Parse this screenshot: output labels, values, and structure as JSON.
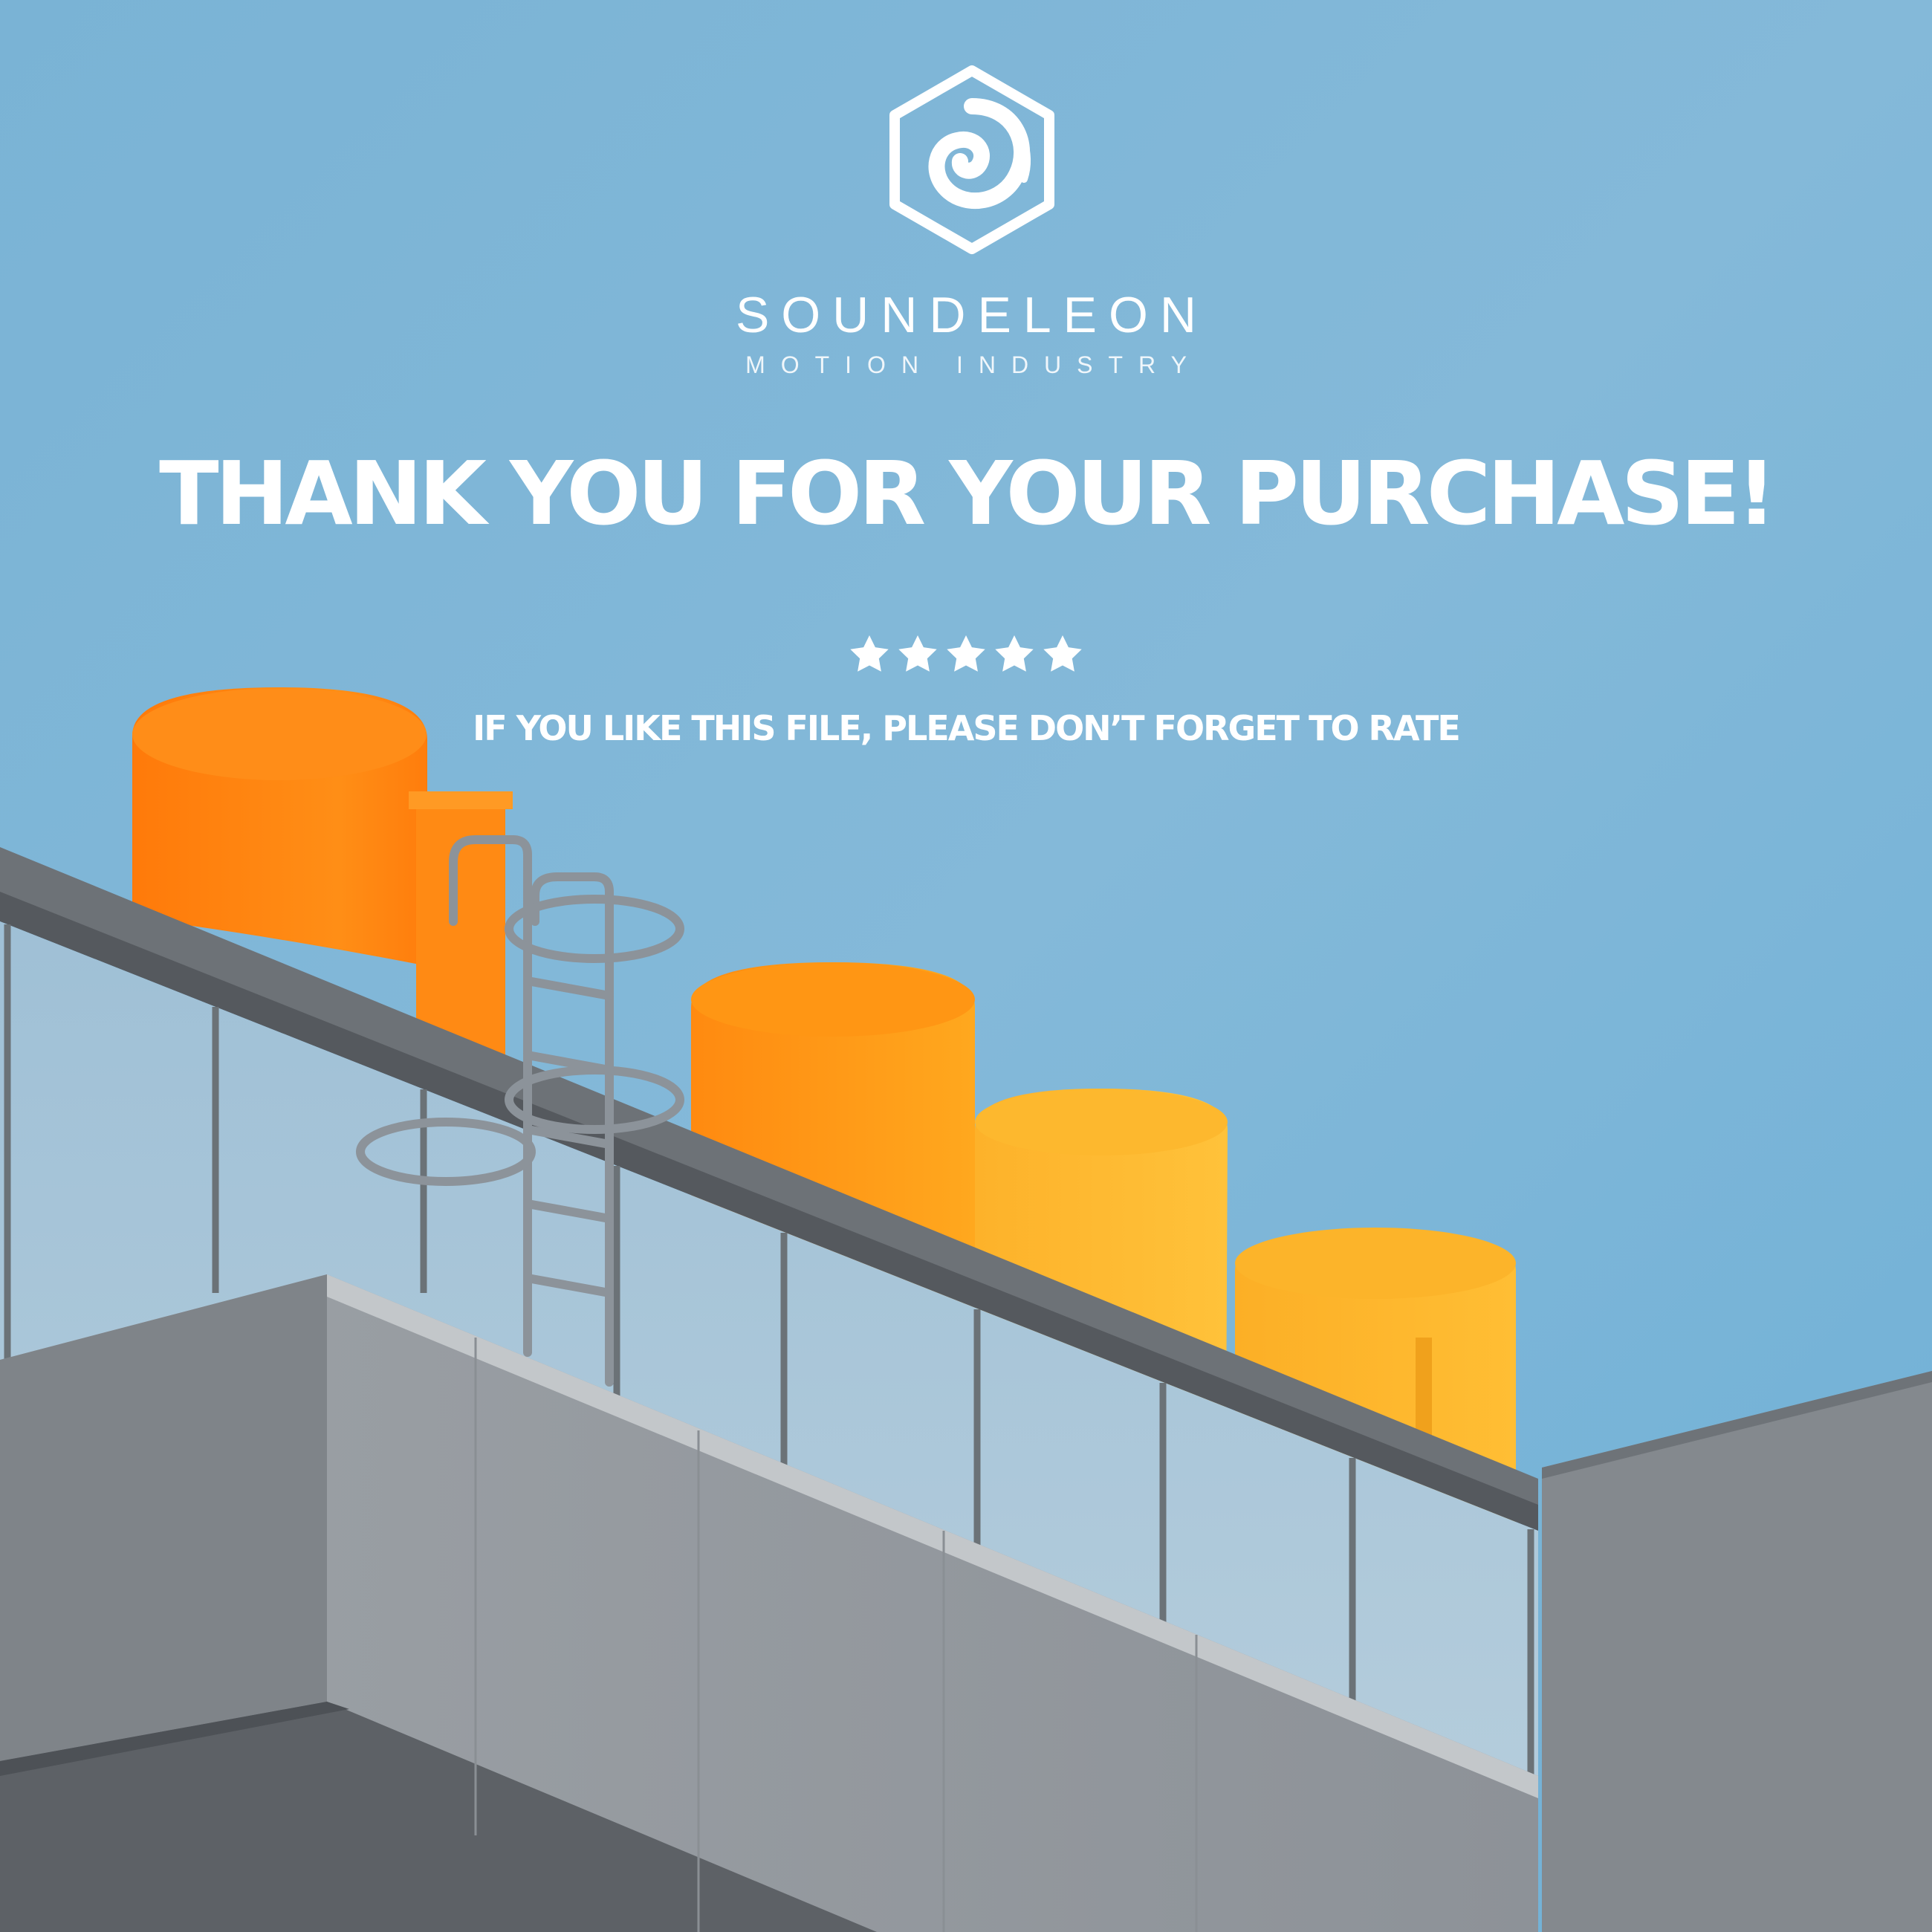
{
  "brand": {
    "name": "SOUNDELEON",
    "tagline": "MOTION INDUSTRY",
    "logo_icon": "hexagon-swirl-icon"
  },
  "headline": "THANK YOU FOR YOUR PURCHASE!",
  "rating": {
    "stars": 5,
    "max": 5,
    "icon": "star-icon"
  },
  "rate_message": "IF YOU LIKE THIS FILE, PLEASE DON’T FORGET TO RATE",
  "colors": {
    "sky": "#79b4d6",
    "text": "#ffffff",
    "orange": "#ff8c14",
    "yellow": "#fdb42a",
    "building": "#8f959b"
  }
}
